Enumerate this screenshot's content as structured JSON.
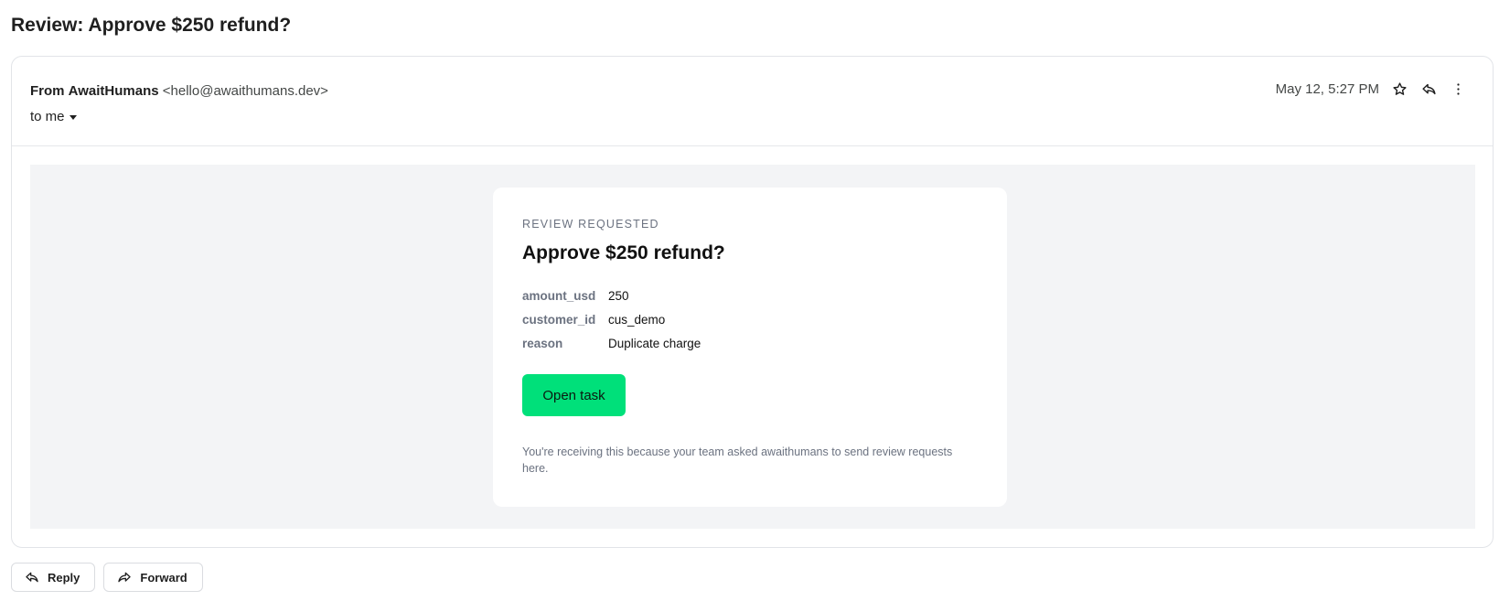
{
  "subject": "Review: Approve $250 refund?",
  "header": {
    "from_prefix": "From",
    "sender_name": "AwaitHumans",
    "sender_email": "<hello@awaithumans.dev>",
    "to_label": "to me",
    "date": "May 12, 5:27 PM",
    "icons": [
      "star-icon",
      "reply-icon",
      "more-vert-icon"
    ]
  },
  "email_card": {
    "eyebrow": "REVIEW REQUESTED",
    "title": "Approve $250 refund?",
    "fields": [
      {
        "key": "amount_usd",
        "value": "250"
      },
      {
        "key": "customer_id",
        "value": "cus_demo"
      },
      {
        "key": "reason",
        "value": "Duplicate charge"
      }
    ],
    "button_label": "Open task",
    "button_color": "#00e07a",
    "footnote": "You're receiving this because your team asked awaithumans to send review requests here."
  },
  "actions": {
    "reply_label": "Reply",
    "forward_label": "Forward"
  }
}
